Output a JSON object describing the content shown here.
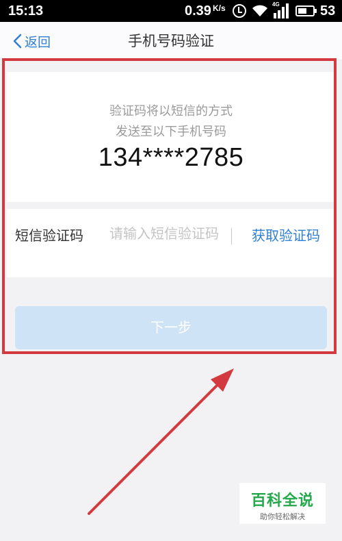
{
  "status_bar": {
    "time": "15:13",
    "network_speed": "0.39",
    "speed_unit": "K/s",
    "network_type": "4G",
    "battery_level": "53"
  },
  "nav": {
    "back_label": "返回",
    "title": "手机号码验证"
  },
  "info": {
    "line1": "验证码将以短信的方式",
    "line2": "发送至以下手机号码",
    "phone_number": "134****2785"
  },
  "code_row": {
    "label": "短信验证码",
    "placeholder": "请输入短信验证码",
    "get_code_label": "获取验证码"
  },
  "next_button": {
    "label": "下一步"
  },
  "watermark": {
    "title": "百科全说",
    "subtitle": "助你轻松解决"
  },
  "colors": {
    "accent": "#2f7fd6",
    "annotation_red": "#d23a3f",
    "disabled_button": "#cfe3f7",
    "watermark_green": "#24a84b"
  }
}
